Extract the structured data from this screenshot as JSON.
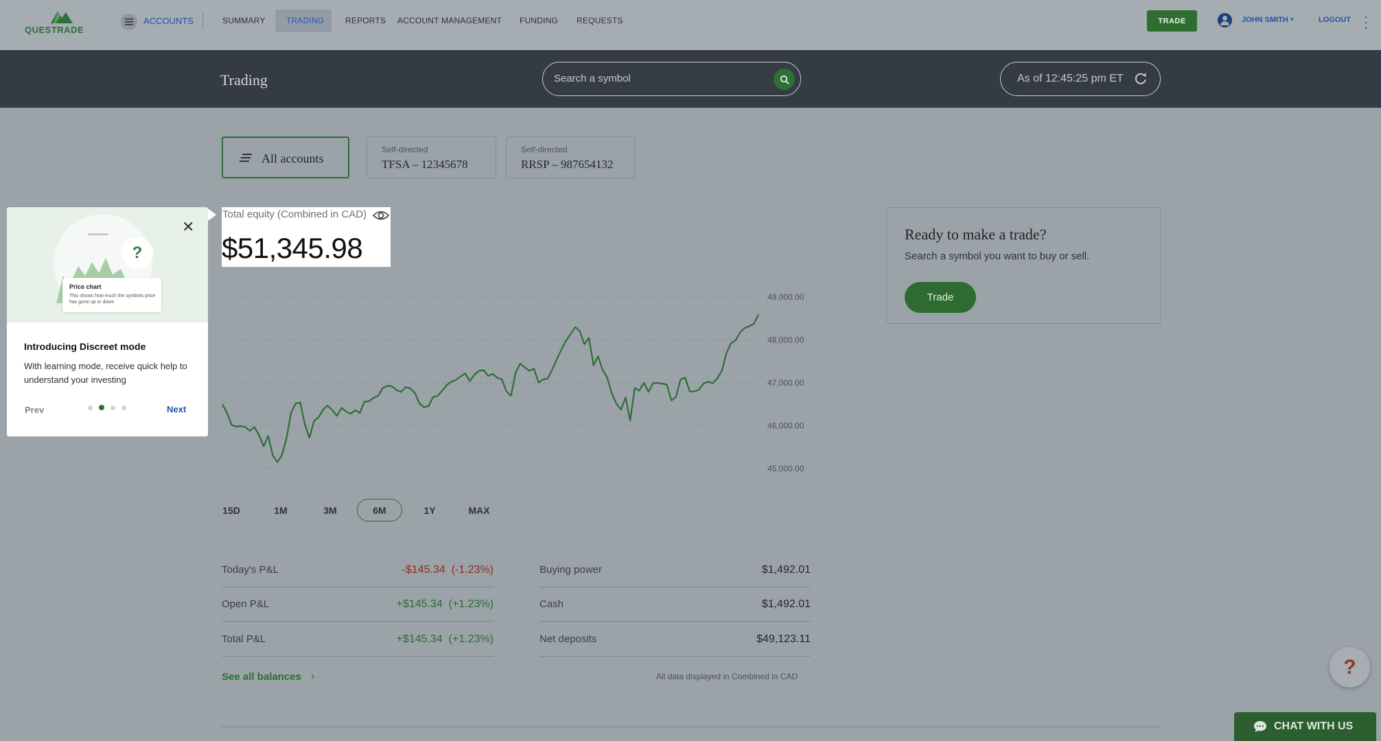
{
  "brand": {
    "name": "QUESTRADE",
    "accent": "#2e6d34"
  },
  "topnav": {
    "accounts_label": "ACCOUNTS",
    "items": [
      {
        "label": "SUMMARY"
      },
      {
        "label": "TRADING",
        "active": true
      },
      {
        "label": "REPORTS"
      },
      {
        "label": "ACCOUNT MANAGEMENT"
      },
      {
        "label": "FUNDING"
      },
      {
        "label": "REQUESTS"
      }
    ],
    "trade_button": "TRADE",
    "user_name": "JOHN SMITH",
    "logout": "LOGOUT"
  },
  "header": {
    "title": "Trading",
    "search_placeholder": "Search a symbol",
    "as_of": "As of 12:45:25 pm ET"
  },
  "accounts": {
    "all_label": "All accounts",
    "cards": [
      {
        "type": "Self-directed",
        "name": "TFSA – 12345678"
      },
      {
        "type": "Self-directed",
        "name": "RRSP – 987654132"
      }
    ]
  },
  "equity": {
    "label": "Total equity (Combined in CAD)",
    "value": "$51,345.98"
  },
  "tooltip": {
    "illustration_title": "Price chart",
    "illustration_body": "This shows how much the symbols price has gone up or down",
    "title": "Introducing Discreet mode",
    "body": "With learning mode, receive quick help to understand your investing",
    "prev": "Prev",
    "next": "Next",
    "step": 2,
    "total_steps": 4
  },
  "chart_data": {
    "type": "line",
    "title": "",
    "xlabel": "",
    "ylabel": "",
    "ylim": [
      45000,
      49000
    ],
    "y_ticks": [
      "49,000.00",
      "48,000.00",
      "47,000.00",
      "46,000.00",
      "45,000.00"
    ],
    "grid": true,
    "series": [
      {
        "color": "#2e6d34",
        "values": [
          46500,
          46300,
          46020,
          45980,
          45990,
          45970,
          45880,
          45970,
          45780,
          45520,
          45760,
          45310,
          45150,
          45320,
          45710,
          46310,
          46520,
          46540,
          46030,
          45720,
          46110,
          46200,
          46380,
          46470,
          46360,
          46230,
          46420,
          46330,
          46280,
          46360,
          46300,
          46560,
          46570,
          46650,
          46700,
          46880,
          46930,
          46920,
          46830,
          46790,
          46900,
          46870,
          46770,
          46520,
          46430,
          46460,
          46670,
          46700,
          46820,
          46950,
          47030,
          47070,
          47150,
          47220,
          47040,
          47190,
          47280,
          47300,
          47160,
          47210,
          47120,
          47080,
          46800,
          46700,
          47240,
          47450,
          47360,
          47280,
          47330,
          47010,
          47080,
          47100,
          47310,
          47550,
          47780,
          47980,
          48140,
          48300,
          48210,
          47900,
          48050,
          47410,
          47620,
          47300,
          47120,
          46750,
          46510,
          46380,
          46660,
          46120,
          46880,
          46820,
          47000,
          46790,
          46990,
          47000,
          46980,
          46960,
          46590,
          46670,
          47080,
          47120,
          46800,
          46800,
          46840,
          46980,
          47030,
          46990,
          47100,
          47280,
          47690,
          47920,
          47990,
          48180,
          48280,
          48320,
          48380,
          48590
        ]
      }
    ]
  },
  "periods": [
    {
      "label": "15D"
    },
    {
      "label": "1M"
    },
    {
      "label": "3M"
    },
    {
      "label": "6M",
      "active": true
    },
    {
      "label": "1Y"
    },
    {
      "label": "MAX"
    }
  ],
  "stats": {
    "left": [
      {
        "label": "Today's P&L",
        "value": "-$145.34",
        "pct": "(-1.23%)",
        "tone": "neg"
      },
      {
        "label": "Open P&L",
        "value": "+$145.34",
        "pct": "(+1.23%)",
        "tone": "pos"
      },
      {
        "label": "Total P&L",
        "value": "+$145.34",
        "pct": "(+1.23%)",
        "tone": "pos"
      }
    ],
    "right": [
      {
        "label": "Buying power",
        "value": "$1,492.01"
      },
      {
        "label": "Cash",
        "value": "$1,492.01"
      },
      {
        "label": "Net deposits",
        "value": "$49,123.11"
      }
    ],
    "see_all": "See all balances",
    "note": "All data displayed in Combined in CAD"
  },
  "trade_card": {
    "title": "Ready to make a trade?",
    "subtitle": "Search a symbol you want to buy or sell.",
    "button": "Trade"
  },
  "help": {
    "label": "?"
  },
  "chat": {
    "label": "CHAT WITH US"
  }
}
